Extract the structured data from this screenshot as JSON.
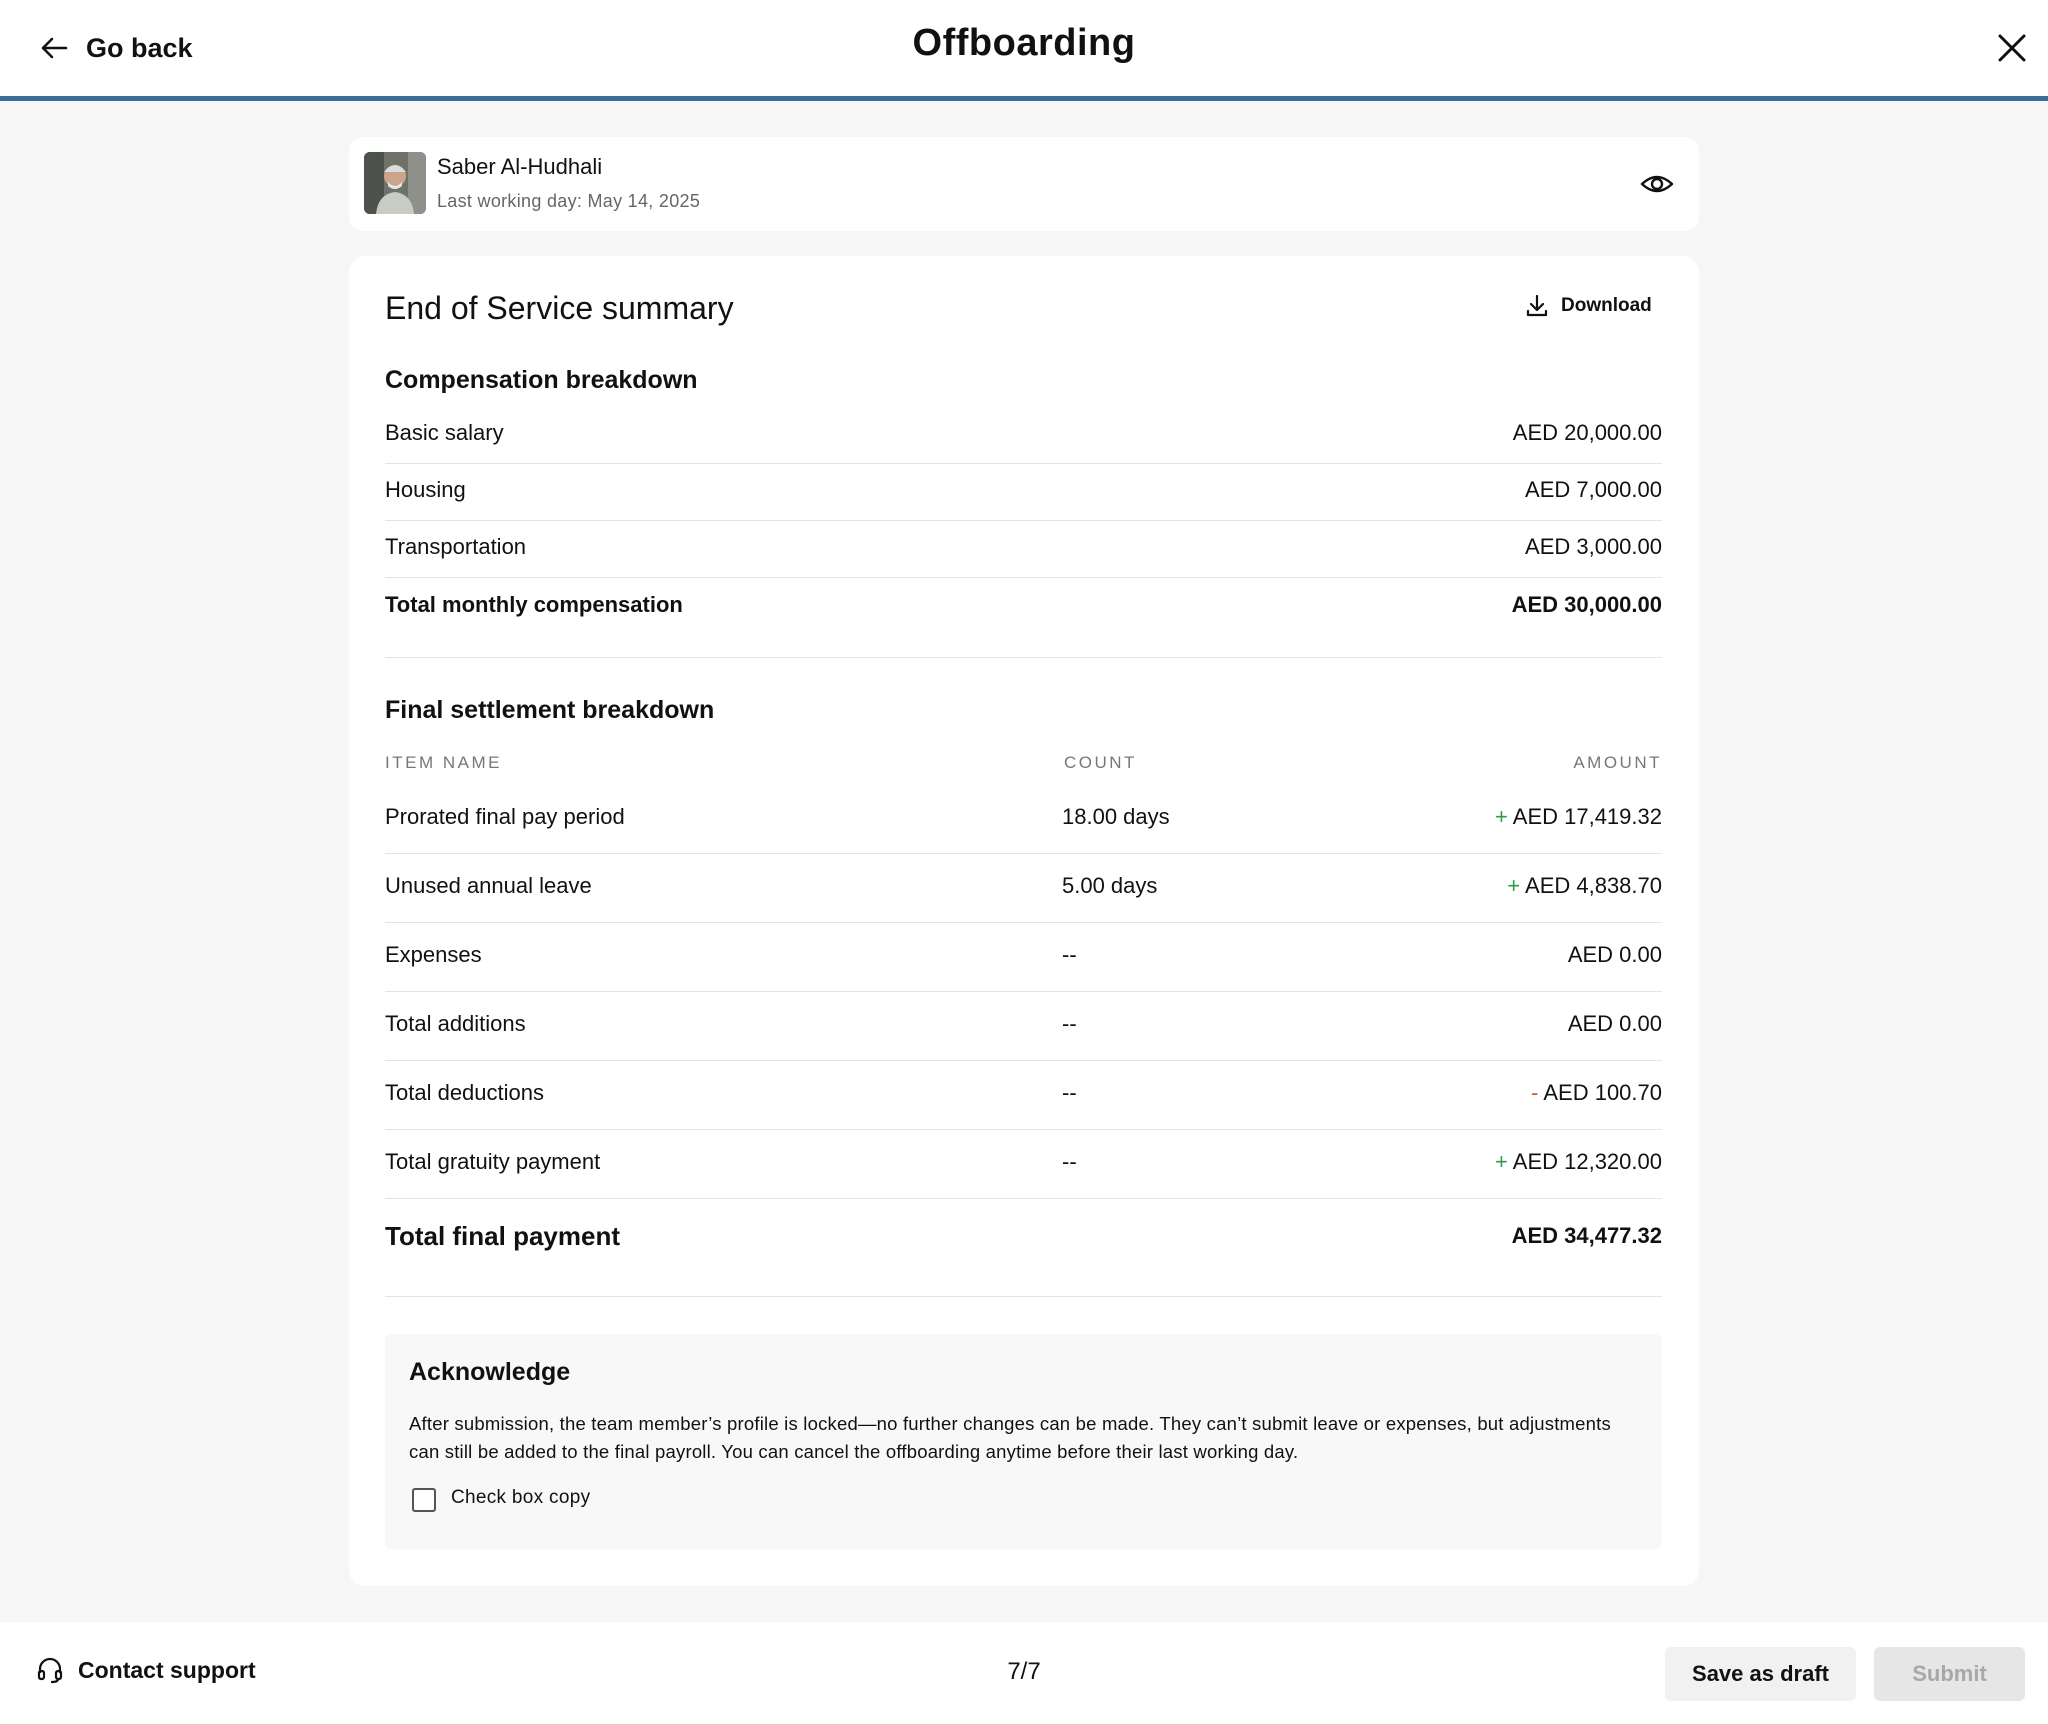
{
  "header": {
    "back_label": "Go back",
    "title": "Offboarding",
    "back_icon": "arrow-left-icon",
    "close_icon": "close-icon"
  },
  "employee": {
    "name": "Saber Al-Hudhali",
    "last_working_day": "Last working day: May 14, 2025",
    "view_icon": "eye-icon"
  },
  "summary": {
    "title": "End of Service summary",
    "download_label": "Download",
    "download_icon": "download-icon"
  },
  "compensation": {
    "title": "Compensation breakdown",
    "rows": [
      {
        "label": "Basic salary",
        "value": "AED 20,000.00"
      },
      {
        "label": "Housing",
        "value": "AED 7,000.00"
      },
      {
        "label": "Transportation",
        "value": "AED 3,000.00"
      }
    ],
    "total_label": "Total monthly compensation",
    "total_value": "AED 30,000.00"
  },
  "settlement": {
    "title": "Final settlement breakdown",
    "columns": {
      "item": "ITEM NAME",
      "count": "COUNT",
      "amount": "AMOUNT"
    },
    "rows": [
      {
        "name": "Prorated final pay period",
        "count": "18.00 days",
        "sign": "+",
        "amount": "AED 17,419.32"
      },
      {
        "name": "Unused annual leave",
        "count": "5.00 days",
        "sign": "+",
        "amount": "AED 4,838.70"
      },
      {
        "name": "Expenses",
        "count": "--",
        "sign": "",
        "amount": "AED 0.00"
      },
      {
        "name": "Total additions",
        "count": "--",
        "sign": "",
        "amount": "AED 0.00"
      },
      {
        "name": "Total deductions",
        "count": "--",
        "sign": "-",
        "amount": "AED 100.70"
      },
      {
        "name": "Total gratuity payment",
        "count": "--",
        "sign": "+",
        "amount": "AED 12,320.00"
      }
    ],
    "final_label": "Total final payment",
    "final_value": "AED 34,477.32"
  },
  "acknowledge": {
    "title": "Acknowledge",
    "text": "After submission, the team member’s profile is locked—no further changes can be made. They can’t submit leave or expenses, but adjustments can still be added to the final payroll. You can cancel the offboarding anytime before their last working day.",
    "checkbox_label": "Check box copy",
    "checked": false
  },
  "footer": {
    "support_label": "Contact support",
    "support_icon": "headset-icon",
    "step": "7/7",
    "draft_label": "Save as draft",
    "submit_label": "Submit"
  },
  "colors": {
    "accent_line": "#3a6f98",
    "positive": "#2e9d47",
    "negative": "#d9532c",
    "background": "#f6f6f6"
  }
}
